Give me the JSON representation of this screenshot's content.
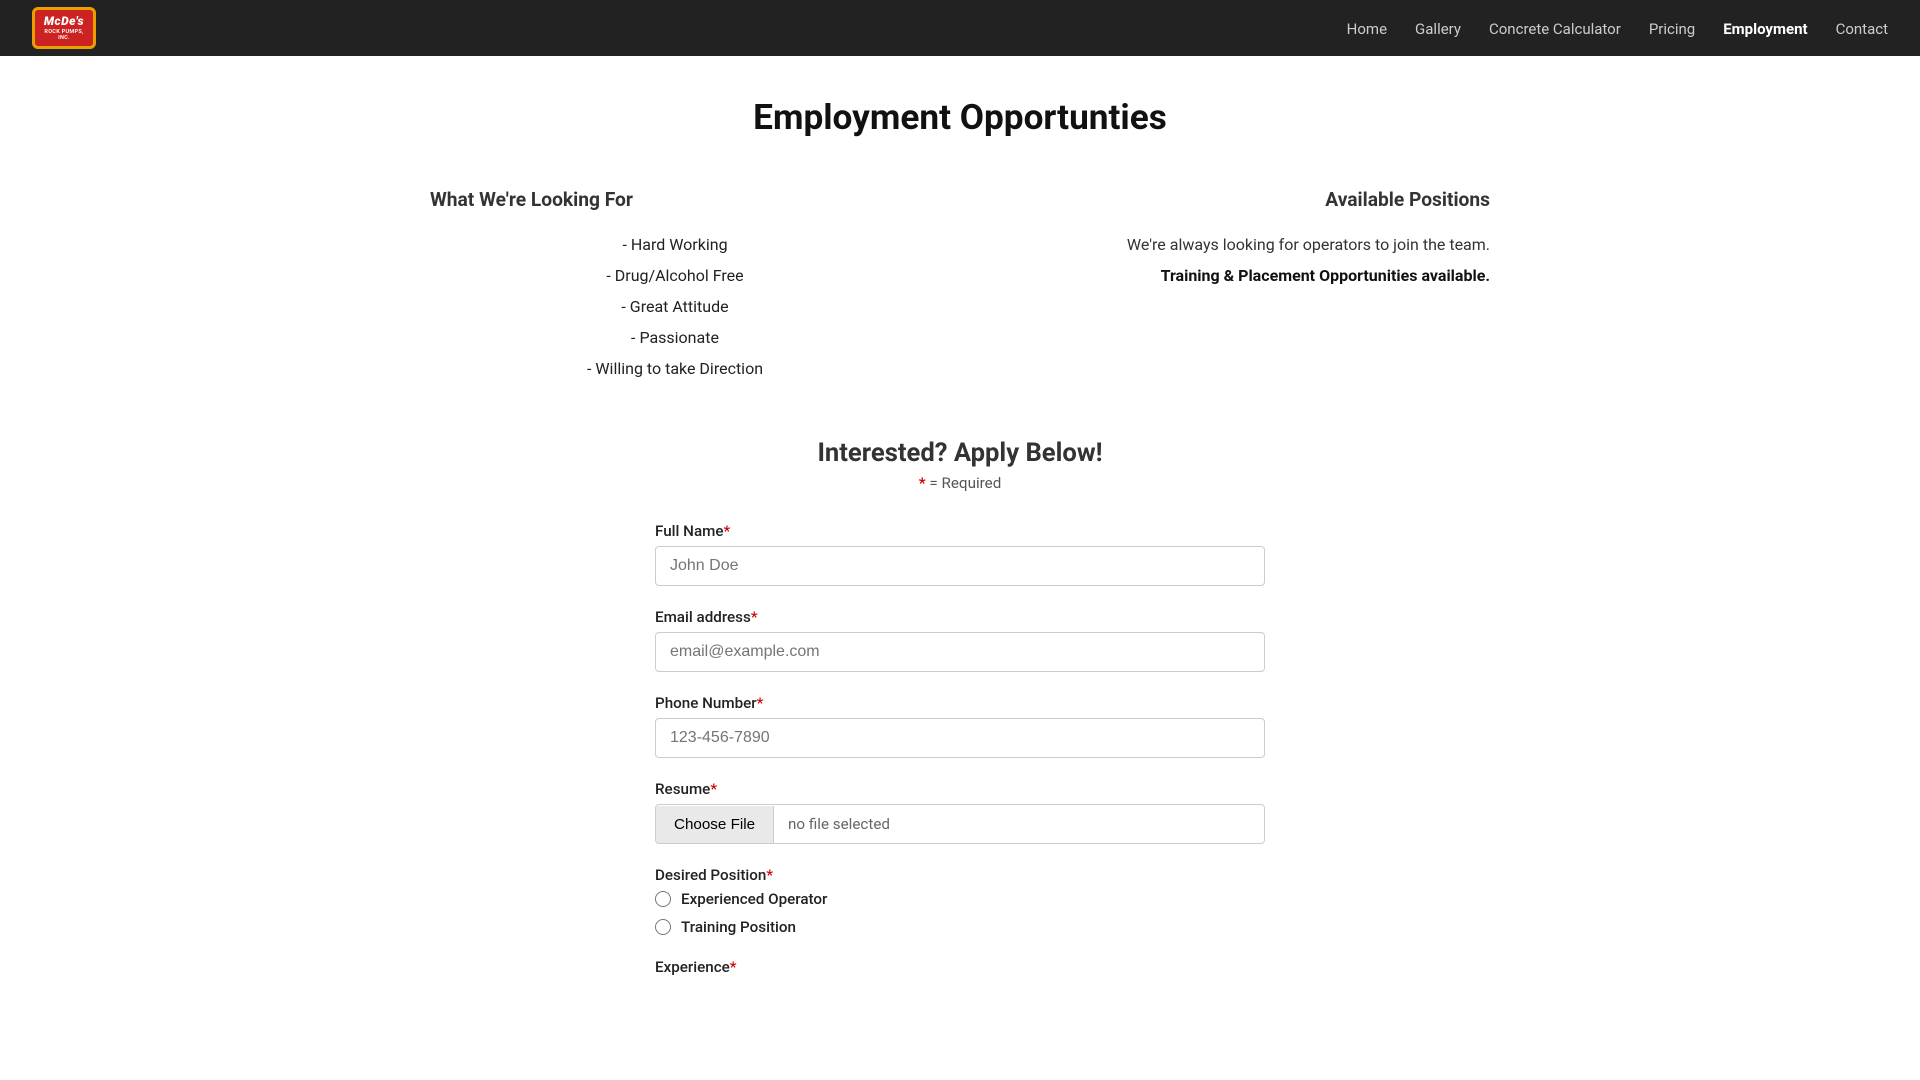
{
  "nav": {
    "logo": {
      "line1": "McDe's",
      "line2": "ROCK PUMPS, INC."
    },
    "links": [
      {
        "label": "Home",
        "active": false
      },
      {
        "label": "Gallery",
        "active": false
      },
      {
        "label": "Concrete Calculator",
        "active": false
      },
      {
        "label": "Pricing",
        "active": false
      },
      {
        "label": "Employment",
        "active": true
      },
      {
        "label": "Contact",
        "active": false
      }
    ]
  },
  "page": {
    "title": "Employment Opportunties",
    "looking_for": {
      "heading": "What We're Looking For",
      "qualities": [
        "- Hard Working",
        "- Drug/Alcohol Free",
        "- Great Attitude",
        "- Passionate",
        "- Willing to take Direction"
      ]
    },
    "positions": {
      "heading": "Available Positions",
      "desc": "We're always looking for operators to join the team.",
      "bold": "Training & Placement Opportunities available."
    },
    "form_section": {
      "heading": "Interested? Apply Below!",
      "required_note": "= Required"
    },
    "form": {
      "full_name": {
        "label": "Full Name",
        "placeholder": "John Doe"
      },
      "email": {
        "label": "Email address",
        "placeholder": "email@example.com"
      },
      "phone": {
        "label": "Phone Number",
        "placeholder": "123-456-7890"
      },
      "resume": {
        "label": "Resume",
        "button_label": "Choose File",
        "file_name": "no file selected"
      },
      "desired_position": {
        "label": "Desired Position",
        "options": [
          "Experienced Operator",
          "Training Position"
        ]
      },
      "experience": {
        "label": "Experience"
      }
    }
  }
}
